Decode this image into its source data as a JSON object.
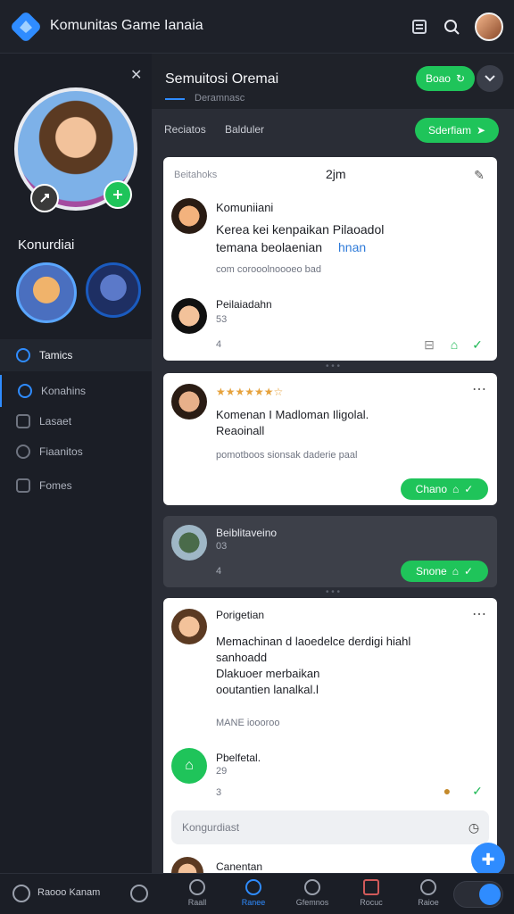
{
  "app": {
    "title": "Komunitas Game Ianaia"
  },
  "colors": {
    "accent_green": "#1fc45a",
    "accent_blue": "#2f8cff",
    "bg_dark": "#1b1e26",
    "card_bg": "#ffffff"
  },
  "sidebar": {
    "close_icon": "close-icon",
    "profile_name": "Konurdiai",
    "nav": [
      {
        "label": "Tamics",
        "icon": "circle-icon",
        "active": true
      },
      {
        "label": "Konahins",
        "icon": "check-circle-icon"
      },
      {
        "label": "Lasaet",
        "icon": "square-icon"
      },
      {
        "label": "Fiaanitos",
        "icon": "target-icon"
      },
      {
        "label": "Fomes",
        "icon": "image-icon"
      }
    ]
  },
  "main": {
    "title": "Semuitosi Oremai",
    "subtitle": "Deramnasc",
    "head_button": "Boao",
    "filters": [
      "Reciatos",
      "Balduler"
    ],
    "filter_button": "Sderfiam",
    "cards": [
      {
        "header_left": "Beitahoks",
        "header_time": "2jm",
        "author": "Komuniiani",
        "text_lines": [
          "Kerea kei kenpaikan Pilaoadol",
          "temana beolaenian",
          "hnan"
        ],
        "meta": "com corooolnoooeo bad",
        "reply_author": "Peilaiadahn",
        "reply_meta": "53",
        "count": "4"
      },
      {
        "rating": "★★★★★★☆",
        "text_lines": [
          "Komenan I Madloman Iligolal.",
          "Reaoinall"
        ],
        "meta": "pomotboos sionsak daderie paal",
        "button": "Chano"
      },
      {
        "author": "Beiblitaveino",
        "meta": "03",
        "count": "4",
        "button": "Snone"
      },
      {
        "author": "Porigetian",
        "text_lines": [
          "Memachinan d laoedelce derdigi hiahl",
          "sanhoadd",
          "Dlakuoer merbaikan",
          "ooutantien lanalkal.l"
        ],
        "meta": "MANE ioooroo",
        "reply_author": "Pbelfetal.",
        "reply_meta": "29",
        "count": "3",
        "input_placeholder": "Kongurdiast",
        "next_author": "Canentan"
      }
    ]
  },
  "bottom": {
    "profile_label": "Raooo Kanam",
    "items": [
      "Raall",
      "Ranee",
      "Gfemnos",
      "Rocuc",
      "Raioe"
    ]
  }
}
